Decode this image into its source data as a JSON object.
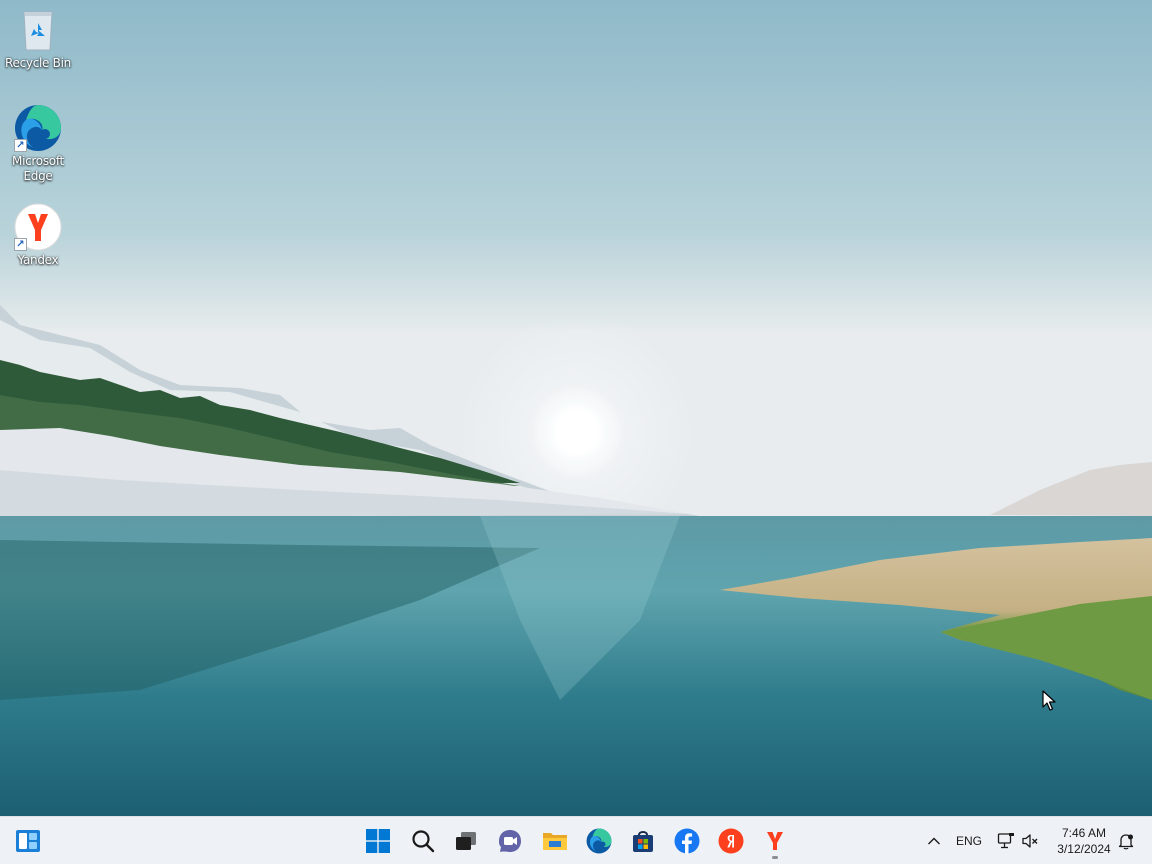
{
  "desktop": {
    "icons": [
      {
        "label": "Recycle Bin",
        "icon": "recycle-bin-icon"
      },
      {
        "label": "Microsoft Edge",
        "icon": "edge-icon",
        "shortcut": true
      },
      {
        "label": "Yandex",
        "icon": "yandex-browser-icon",
        "shortcut": true
      }
    ]
  },
  "taskbar": {
    "pinned": [
      {
        "name": "widgets",
        "icon": "widgets-icon"
      },
      {
        "name": "start",
        "icon": "windows-start-icon"
      },
      {
        "name": "search",
        "icon": "search-icon"
      },
      {
        "name": "task-view",
        "icon": "task-view-icon"
      },
      {
        "name": "chat",
        "icon": "chat-icon"
      },
      {
        "name": "file-explorer",
        "icon": "folder-icon"
      },
      {
        "name": "edge",
        "icon": "edge-icon"
      },
      {
        "name": "microsoft-store",
        "icon": "store-icon"
      },
      {
        "name": "facebook",
        "icon": "facebook-icon"
      },
      {
        "name": "yandex",
        "icon": "yandex-icon"
      },
      {
        "name": "yandex-browser",
        "icon": "yandex-browser-icon",
        "running": true
      }
    ],
    "tray": {
      "overflow_icon": "chevron-up-icon",
      "language": "ENG",
      "network_icon": "network-icon",
      "volume_icon": "volume-muted-icon",
      "time": "7:46 AM",
      "date": "3/12/2024",
      "notification_icon": "notification-bell-icon"
    }
  },
  "colors": {
    "sky_top": "#8fb9c9",
    "sky_horizon": "#e8ecef",
    "water": "#2f7c8c",
    "taskbar_bg": "#eef2f7",
    "windows_blue": "#0078d4",
    "facebook_blue": "#1877f2",
    "yandex_red": "#fc3f1d"
  }
}
